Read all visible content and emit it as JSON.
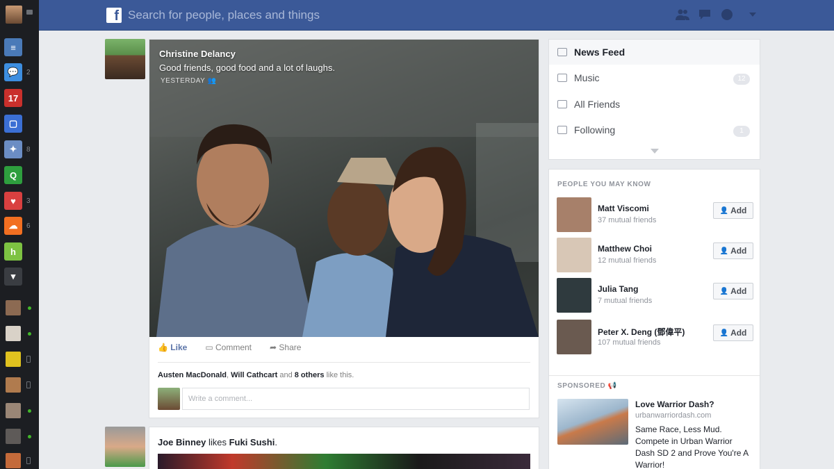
{
  "app": {
    "brand_color": "#3b5998",
    "search_placeholder": "Search for people, places and things"
  },
  "rail": {
    "apps": [
      {
        "name": "newsfeed-app",
        "color": "#4a7ab8",
        "glyph": "≡",
        "count": ""
      },
      {
        "name": "messages-app",
        "color": "#3d8ee0",
        "glyph": "💬",
        "count": "2"
      },
      {
        "name": "calendar-app",
        "color": "#c9302c",
        "glyph": "17",
        "count": ""
      },
      {
        "name": "notes-app",
        "color": "#3b6fd4",
        "glyph": "▢",
        "count": ""
      },
      {
        "name": "photos-app",
        "color": "#6b8dc4",
        "glyph": "✦",
        "count": "8"
      },
      {
        "name": "search-app",
        "color": "#2e9e3e",
        "glyph": "Q",
        "count": ""
      },
      {
        "name": "health-app",
        "color": "#d94040",
        "glyph": "♥",
        "count": "3"
      },
      {
        "name": "soundcloud-app",
        "color": "#f26f21",
        "glyph": "☁",
        "count": "6"
      },
      {
        "name": "houzz-app",
        "color": "#7dc242",
        "glyph": "h",
        "count": ""
      }
    ],
    "more_glyph": "▾"
  },
  "feed": {
    "post1": {
      "author": "Christine Delancy",
      "caption": "Good friends, good food and a lot of laughs.",
      "time": "YESTERDAY",
      "actions": {
        "like": "Like",
        "comment": "Comment",
        "share": "Share"
      },
      "likes": {
        "name1": "Austen MacDonald",
        "sep1": ", ",
        "name2": "Will Cathcart",
        "sep2": " and ",
        "others": "8 others",
        "suffix": " like this."
      },
      "comment_placeholder": "Write a comment..."
    },
    "post2": {
      "author": "Joe Binney",
      "verb": " likes ",
      "page": "Fuki Sushi",
      "end": "."
    }
  },
  "sidebar": {
    "nav": [
      {
        "label": "News Feed",
        "badge": ""
      },
      {
        "label": "Music",
        "badge": "12"
      },
      {
        "label": "All Friends",
        "badge": ""
      },
      {
        "label": "Following",
        "badge": "1"
      }
    ],
    "pymk_title": "PEOPLE YOU MAY KNOW",
    "add_label": "Add",
    "people": [
      {
        "name": "Matt Viscomi",
        "mutual": "37 mutual friends"
      },
      {
        "name": "Matthew Choi",
        "mutual": "12 mutual friends"
      },
      {
        "name": "Julia Tang",
        "mutual": "7 mutual friends"
      },
      {
        "name": "Peter X. Deng (鄧偉平)",
        "mutual": "107 mutual friends"
      }
    ],
    "sponsored_title": "SPONSORED",
    "ad": {
      "title": "Love Warrior Dash?",
      "url": "urbanwarriordash.com",
      "body": "Same Race, Less Mud. Compete in Urban Warrior Dash SD 2 and Prove You're A Warrior!"
    }
  }
}
